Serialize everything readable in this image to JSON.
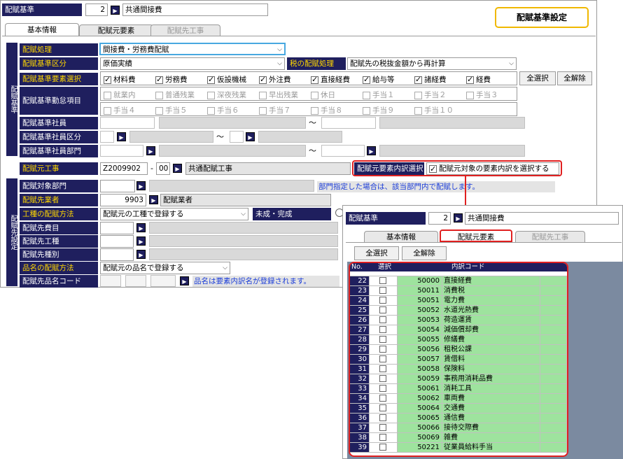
{
  "main": {
    "header_label": "配賦基準",
    "header_no": "2",
    "header_name": "共通間接費",
    "title_box": "配賦基準設定",
    "tabs": [
      "基本情報",
      "配賦元要素",
      "配賦先工事"
    ],
    "section1": "配賦基準",
    "section2": "配賦先設定",
    "rows": {
      "shori_label": "配賦処理",
      "shori_value": "間接費・労務費配賦",
      "kubun_label": "配賦基準区分",
      "kubun_value": "原価実績",
      "tax_label": "税の配賦処理",
      "tax_value": "配賦先の税抜金額から再計算",
      "yoso_label": "配賦基準要素選択",
      "yoso_items": [
        "材料費",
        "労務費",
        "仮設機械",
        "外注費",
        "直接経費",
        "給与等",
        "諸経費",
        "経費"
      ],
      "select_all": "全選択",
      "deselect_all": "全解除",
      "kinmu_label": "配賦基準勤怠項目",
      "kinmu_row1": [
        "就業内",
        "普通残業",
        "深夜残業",
        "早出残業",
        "休日",
        "手当１",
        "手当２",
        "手当３"
      ],
      "kinmu_row2": [
        "手当４",
        "手当５",
        "手当６",
        "手当７",
        "手当８",
        "手当９",
        "手当１０"
      ],
      "shain_label": "配賦基準社員",
      "shain_kubun_label": "配賦基準社員区分",
      "shain_bumon_label": "配賦基準社員部門",
      "tilde": "〜",
      "motokoji_label": "配賦元工事",
      "motokoji_code": "Z2009902",
      "motokoji_dash": "-",
      "motokoji_sub": "00",
      "motokoji_name": "共通配賦工事",
      "uchiwake_label": "配賦元要素内訳選択",
      "uchiwake_check": "配賦元対象の要素内訳を選択する",
      "taisho_bumon_label": "配賦対象部門",
      "bumon_note": "部門指定した場合は、該当部門内で配賦します。",
      "sakigyo_label": "配賦先業者",
      "sakigyo_code": "9903",
      "sakigyo_name": "配賦業者",
      "koshu_label": "工種の配賦方法",
      "koshu_value": "配賦元の工種で登録する",
      "mise_label": "未成・完成",
      "hiyo_label": "配賦先費目",
      "koshu2_label": "配賦先工種",
      "shubetsu_label": "配賦先種別",
      "hinmei_label": "品名の配賦方法",
      "hinmei_value": "配賦元の品名で登録する",
      "hinmei_code_label": "配賦先品名コード",
      "hinmei_note": "品名は要素内訳名が登録されます。"
    }
  },
  "popup": {
    "header_label": "配賦基準",
    "header_no": "2",
    "header_name": "共通間接費",
    "tabs": [
      "基本情報",
      "配賦元要素",
      "配賦先工事"
    ],
    "select_all": "全選択",
    "deselect_all": "全解除",
    "cols": [
      "No.",
      "選択",
      "内訳コード"
    ],
    "rows": [
      {
        "no": "22",
        "code": "50000",
        "name": "直接経費"
      },
      {
        "no": "23",
        "code": "50011",
        "name": "消費税"
      },
      {
        "no": "24",
        "code": "50051",
        "name": "電力費"
      },
      {
        "no": "25",
        "code": "50052",
        "name": "水道光熱費"
      },
      {
        "no": "26",
        "code": "50053",
        "name": "荷造運賃"
      },
      {
        "no": "27",
        "code": "50054",
        "name": "減価償却費"
      },
      {
        "no": "28",
        "code": "50055",
        "name": "修繕費"
      },
      {
        "no": "29",
        "code": "50056",
        "name": "租税公課"
      },
      {
        "no": "30",
        "code": "50057",
        "name": "賃借料"
      },
      {
        "no": "31",
        "code": "50058",
        "name": "保険料"
      },
      {
        "no": "32",
        "code": "50059",
        "name": "事務用消耗品費"
      },
      {
        "no": "33",
        "code": "50061",
        "name": "消耗工具"
      },
      {
        "no": "34",
        "code": "50062",
        "name": "車両費"
      },
      {
        "no": "35",
        "code": "50064",
        "name": "交通費"
      },
      {
        "no": "36",
        "code": "50065",
        "name": "通信費"
      },
      {
        "no": "37",
        "code": "50066",
        "name": "接待交際費"
      },
      {
        "no": "38",
        "code": "50069",
        "name": "雑費"
      },
      {
        "no": "39",
        "code": "50221",
        "name": "従業員給料手当"
      }
    ]
  },
  "colors": {
    "navy": "#1f1f5e",
    "green": "#9ee39e",
    "highlight_red": "#e02020",
    "title_border": "#f0b800",
    "info_blue": "#1a3cd8"
  }
}
